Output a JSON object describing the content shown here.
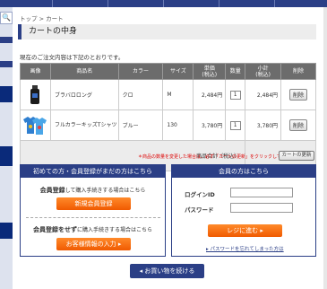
{
  "breadcrumb": {
    "home": "トップ",
    "separator": " > ",
    "current": "カート"
  },
  "page": {
    "title": "カートの中身",
    "intro": "現在のご注文内容は下記のとおりです。",
    "continue_button": "お買い物を続ける"
  },
  "cart": {
    "headers": [
      "画像",
      "商品名",
      "カラー",
      "サイズ",
      "単価",
      "数量",
      "小計",
      "削除"
    ],
    "header_tax_note": "(税込)",
    "items": [
      {
        "name": "ブラバロロング",
        "color": "クロ",
        "size": "M",
        "unit_price": "2,484円",
        "qty": "1",
        "subtotal": "2,484円"
      },
      {
        "name": "フルカラーキッズTシャツ",
        "color": "ブルー",
        "size": "130",
        "unit_price": "3,780円",
        "qty": "1",
        "subtotal": "3,780円"
      }
    ],
    "delete_label": "削除",
    "total_label": "商品合計（税込）",
    "total": "6,264円",
    "note": "＊商品の数量を変更した場合は、必ず「カートの更新」をクリックしてください。",
    "update_label": "カートの更新"
  },
  "guest": {
    "heading": "初めての方・会員登録がまだの方はこちら",
    "register_strong": "会員登録",
    "register_text": "して購入手続きする場合はこちら",
    "register_button": "新規会員登録",
    "noreg_strong": "会員登録をせず",
    "noreg_text": "に購入手続きする場合はこちら",
    "noreg_button": "お客様情報の入力"
  },
  "member": {
    "heading": "会員の方はこちら",
    "id_label": "ログインID",
    "password_label": "パスワード",
    "checkout_button": "レジに進む",
    "forgot_link": "パスワードを忘れてしまった方は"
  },
  "colors": {
    "primary": "#2b3f86",
    "accent": "#f05a00",
    "total": "#e00000"
  }
}
